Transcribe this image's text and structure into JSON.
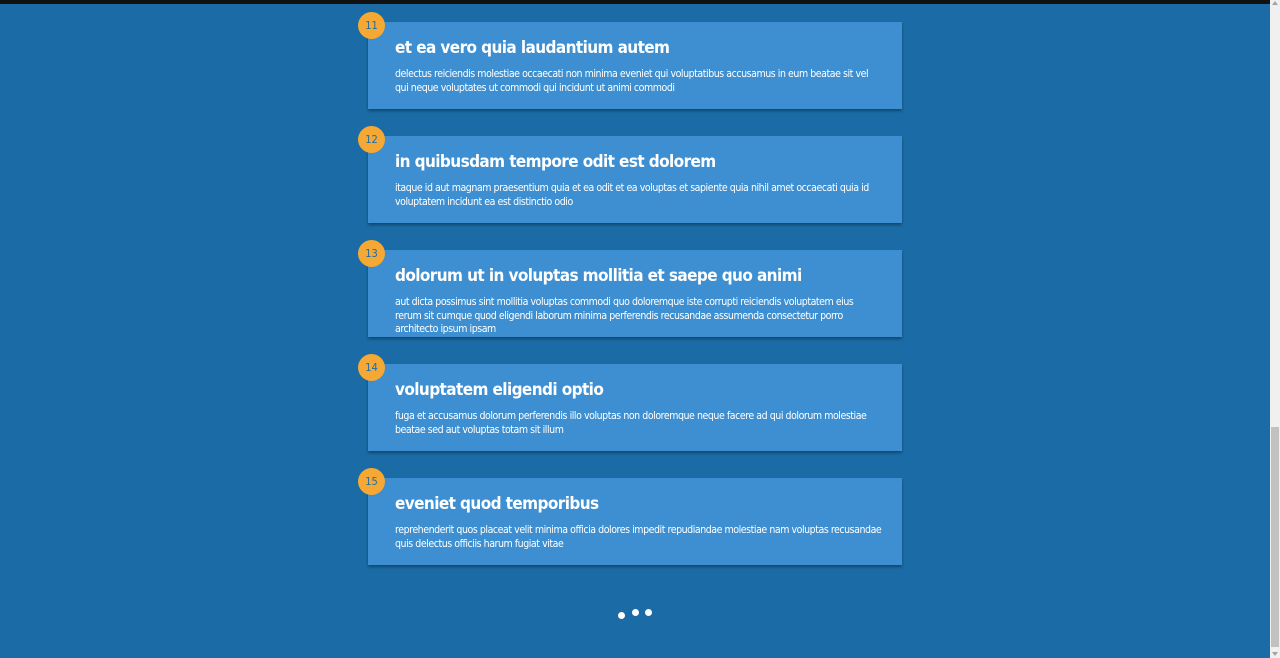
{
  "items": [
    {
      "number": "11",
      "title": "et ea vero quia laudantium autem",
      "body": "delectus reiciendis molestiae occaecati non minima eveniet qui voluptatibus accusamus in eum beatae sit vel qui neque voluptates ut commodi qui incidunt ut animi commodi"
    },
    {
      "number": "12",
      "title": "in quibusdam tempore odit est dolorem",
      "body": "itaque id aut magnam praesentium quia et ea odit et ea voluptas et sapiente quia nihil amet occaecati quia id voluptatem incidunt ea est distinctio odio"
    },
    {
      "number": "13",
      "title": "dolorum ut in voluptas mollitia et saepe quo animi",
      "body": "aut dicta possimus sint mollitia voluptas commodi quo doloremque iste corrupti reiciendis voluptatem eius rerum sit cumque quod eligendi laborum minima perferendis recusandae assumenda consectetur porro architecto ipsum ipsam"
    },
    {
      "number": "14",
      "title": "voluptatem eligendi optio",
      "body": "fuga et accusamus dolorum perferendis illo voluptas non doloremque neque facere ad qui dolorum molestiae beatae sed aut voluptas totam sit illum"
    },
    {
      "number": "15",
      "title": "eveniet quod temporibus",
      "body": "reprehenderit quos placeat velit minima officia dolores impedit repudiandae molestiae nam voluptas recusandae quis delectus officiis harum fugiat vitae"
    }
  ],
  "pager": {
    "dots": 3
  },
  "colors": {
    "background": "#1b6ca6",
    "card": "#3d8fd1",
    "badge": "#f5a833",
    "text": "#ffffff"
  }
}
